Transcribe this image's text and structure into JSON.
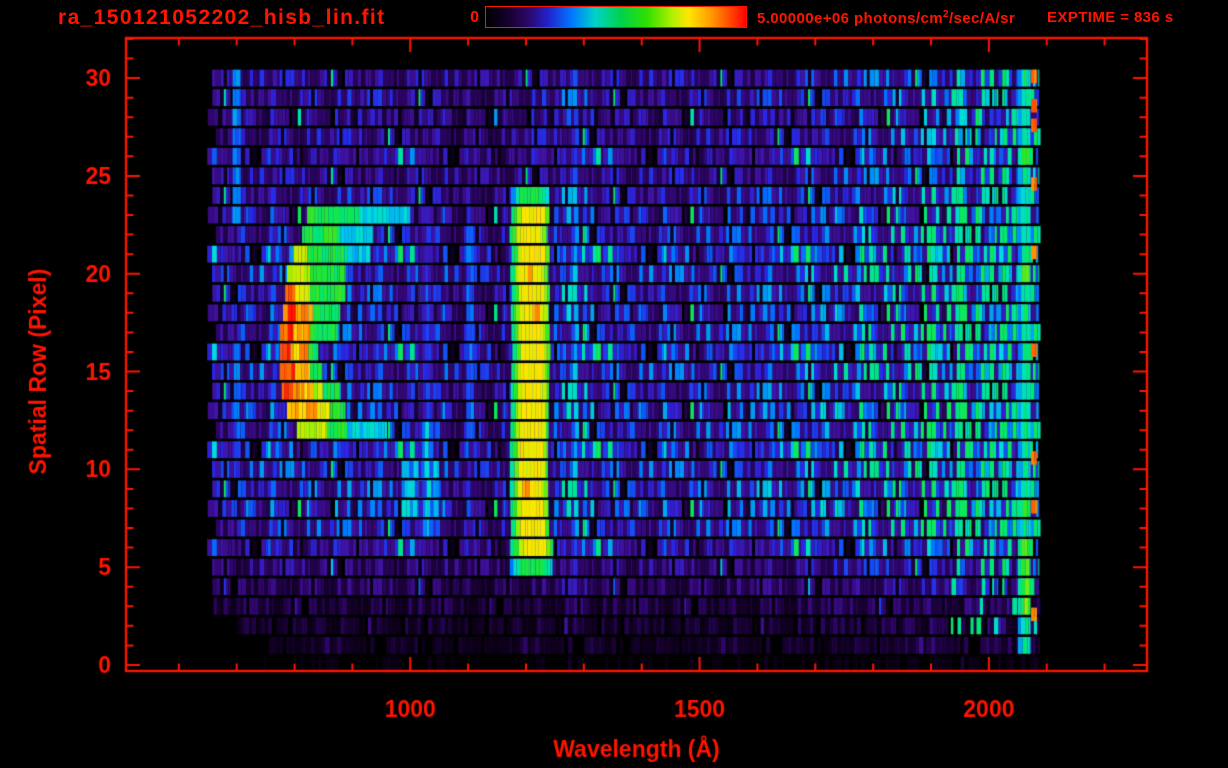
{
  "chart_data": {
    "type": "heatmap",
    "title": "ra_150121052202_hisb_lin.fit",
    "exptime_label": "EXPTIME = 836 s",
    "colorbar": {
      "min_label": "0",
      "max_label_prefix": "5.00000e+06 photons/cm",
      "max_label_sup": "2",
      "max_label_suffix": "/sec/A/sr",
      "gradient": [
        [
          0,
          "#000000"
        ],
        [
          0.08,
          "#140028"
        ],
        [
          0.16,
          "#2c0666"
        ],
        [
          0.24,
          "#2222cc"
        ],
        [
          0.33,
          "#0078ff"
        ],
        [
          0.42,
          "#00d2c8"
        ],
        [
          0.52,
          "#00d24a"
        ],
        [
          0.62,
          "#30e000"
        ],
        [
          0.72,
          "#b4f000"
        ],
        [
          0.78,
          "#ffe600"
        ],
        [
          0.87,
          "#ff9600"
        ],
        [
          0.95,
          "#ff3c00"
        ],
        [
          1,
          "#ff0000"
        ]
      ]
    },
    "xlabel": "Wavelength (Å)",
    "ylabel": "Spatial Row (Pixel)",
    "x_ticks": [
      1000,
      1500,
      2000
    ],
    "x_minor_step": 100,
    "xlim": [
      507,
      2275
    ],
    "y_ticks": [
      0,
      5,
      10,
      15,
      20,
      25,
      30
    ],
    "y_minor_step": 1,
    "ylim": [
      -0.36,
      32.1
    ],
    "axis_color": "#ff1400",
    "data_extent": {
      "lambda": [
        645,
        2090
      ],
      "rows": [
        0,
        30
      ]
    },
    "row_base_levels": [
      0.05,
      0.1,
      0.13,
      0.16,
      0.22,
      0.26,
      0.3,
      0.36,
      0.38,
      0.38,
      0.37,
      0.36,
      0.37,
      0.38,
      0.36,
      0.37,
      0.36,
      0.37,
      0.36,
      0.36,
      0.37,
      0.36,
      0.35,
      0.34,
      0.33,
      0.3,
      0.29,
      0.3,
      0.29,
      0.31,
      0.3
    ],
    "colormap_stops": [
      [
        0,
        "#000000"
      ],
      [
        0.1,
        "#10001f"
      ],
      [
        0.22,
        "#30066e"
      ],
      [
        0.32,
        "#4012a0"
      ],
      [
        0.4,
        "#2828e6"
      ],
      [
        0.48,
        "#0078ff"
      ],
      [
        0.56,
        "#00dcdc"
      ],
      [
        0.64,
        "#00e678"
      ],
      [
        0.7,
        "#28e628"
      ],
      [
        0.78,
        "#aaf000"
      ],
      [
        0.85,
        "#ffe600"
      ],
      [
        0.91,
        "#ff9600"
      ],
      [
        1,
        "#ff1400"
      ]
    ],
    "intensity_modifiers": {
      "left_dim_below_lambda": 700,
      "dip_range": [
        1060,
        1180
      ],
      "blue_wing_range": [
        1250,
        1320
      ],
      "right_ramp_start": 1550,
      "right_ramp_gain": 0.5,
      "green_mix_start": 1930
    },
    "features": {
      "blue_columns": [
        {
          "lambda": [
            693,
            707
          ],
          "rows": [
            23,
            30
          ],
          "level": 0.44
        },
        {
          "lambda": [
            695,
            706
          ],
          "rows": [
            10,
            16
          ],
          "level": 0.42
        },
        {
          "lambda": [
            1097,
            1110
          ],
          "rows": [
            12,
            22
          ],
          "level": 0.42
        }
      ],
      "sub_arc_blob": {
        "lambda": [
          985,
          1050
        ],
        "rows": [
          8,
          10
        ],
        "level": 0.5
      },
      "lyman_beta_line": {
        "lambda": [
          1014,
          1040
        ],
        "rows": [
          7,
          23
        ],
        "core_level": 0.42,
        "bright_rows": [
          7,
          12
        ],
        "bright_level": 0.56
      },
      "lyman_alpha_line": {
        "lambda": [
          1174,
          1240
        ],
        "core": [
          1190,
          1228
        ],
        "rows": [
          5,
          24
        ],
        "core_level": 0.84,
        "edge_level": 0.62,
        "orange_chance": 0.2
      },
      "arc_rows": [
        {
          "row": 23,
          "segments": [
            [
              822,
              913,
              0.68
            ],
            [
              913,
              1000,
              0.55
            ]
          ]
        },
        {
          "row": 22,
          "segments": [
            [
              813,
              879,
              0.68
            ],
            [
              879,
              936,
              0.55
            ]
          ]
        },
        {
          "row": 21,
          "segments": [
            [
              798,
              822,
              0.82
            ],
            [
              822,
              891,
              0.68
            ],
            [
              891,
              931,
              0.55
            ]
          ]
        },
        {
          "row": 20,
          "segments": [
            [
              787,
              827,
              0.82
            ],
            [
              827,
              888,
              0.68
            ]
          ]
        },
        {
          "row": 19,
          "segments": [
            [
              784,
              801,
              0.96
            ],
            [
              801,
              827,
              0.84
            ],
            [
              827,
              888,
              0.68
            ]
          ]
        },
        {
          "row": 18,
          "segments": [
            [
              780,
              805,
              0.96
            ],
            [
              805,
              832,
              0.89
            ],
            [
              832,
              879,
              0.68
            ]
          ]
        },
        {
          "row": 17,
          "segments": [
            [
              775,
              798,
              0.97
            ],
            [
              798,
              827,
              0.89
            ],
            [
              827,
              874,
              0.68
            ]
          ]
        },
        {
          "row": 16,
          "segments": [
            [
              775,
              798,
              0.97
            ],
            [
              798,
              824,
              0.89
            ],
            [
              824,
              841,
              0.68
            ]
          ]
        },
        {
          "row": 15,
          "segments": [
            [
              775,
              801,
              0.97
            ],
            [
              801,
              827,
              0.89
            ],
            [
              827,
              848,
              0.68
            ]
          ]
        },
        {
          "row": 14,
          "segments": [
            [
              778,
              805,
              0.96
            ],
            [
              805,
              832,
              0.89
            ],
            [
              832,
              850,
              0.82
            ],
            [
              850,
              879,
              0.68
            ]
          ]
        },
        {
          "row": 13,
          "segments": [
            [
              787,
              839,
              0.9
            ],
            [
              839,
              862,
              0.82
            ],
            [
              862,
              888,
              0.68
            ]
          ]
        },
        {
          "row": 12,
          "segments": [
            [
              804,
              856,
              0.8
            ],
            [
              856,
              891,
              0.68
            ],
            [
              891,
              960,
              0.55
            ]
          ]
        }
      ],
      "edge_stripe": {
        "lambda": [
          2050,
          2072
        ],
        "rows": [
          1,
          30
        ],
        "core_level": 0.66,
        "edge_level": 0.5
      },
      "red_specks": {
        "lambda": [
          2073,
          2083
        ],
        "rows": [
          30,
          28.5,
          27.5,
          24.5,
          21,
          16,
          10.5,
          8,
          2.5
        ],
        "level": 0.96
      }
    }
  }
}
